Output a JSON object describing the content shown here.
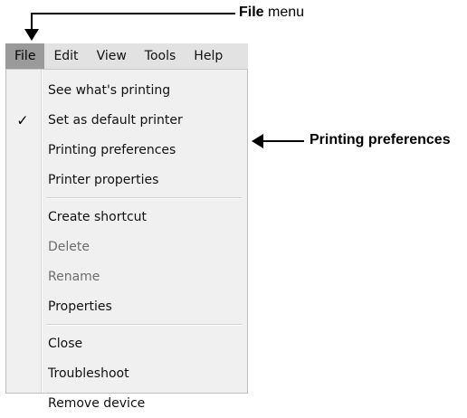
{
  "callouts": {
    "file_menu": {
      "bold": "File",
      "rest": " menu"
    },
    "printing_prefs": "Printing preferences"
  },
  "menubar": {
    "items": [
      {
        "label": "File",
        "active": true
      },
      {
        "label": "Edit"
      },
      {
        "label": "View"
      },
      {
        "label": "Tools"
      },
      {
        "label": "Help"
      }
    ]
  },
  "dropdown": {
    "groups": [
      [
        {
          "label": "See what's printing"
        },
        {
          "label": "Set as default printer",
          "checked": true
        },
        {
          "label": "Printing preferences"
        },
        {
          "label": "Printer properties"
        }
      ],
      [
        {
          "label": "Create shortcut"
        },
        {
          "label": "Delete",
          "disabled": true
        },
        {
          "label": "Rename",
          "disabled": true
        },
        {
          "label": "Properties"
        }
      ],
      [
        {
          "label": "Close"
        },
        {
          "label": "Troubleshoot"
        },
        {
          "label": "Remove device"
        }
      ]
    ],
    "check_glyph": "✓"
  }
}
